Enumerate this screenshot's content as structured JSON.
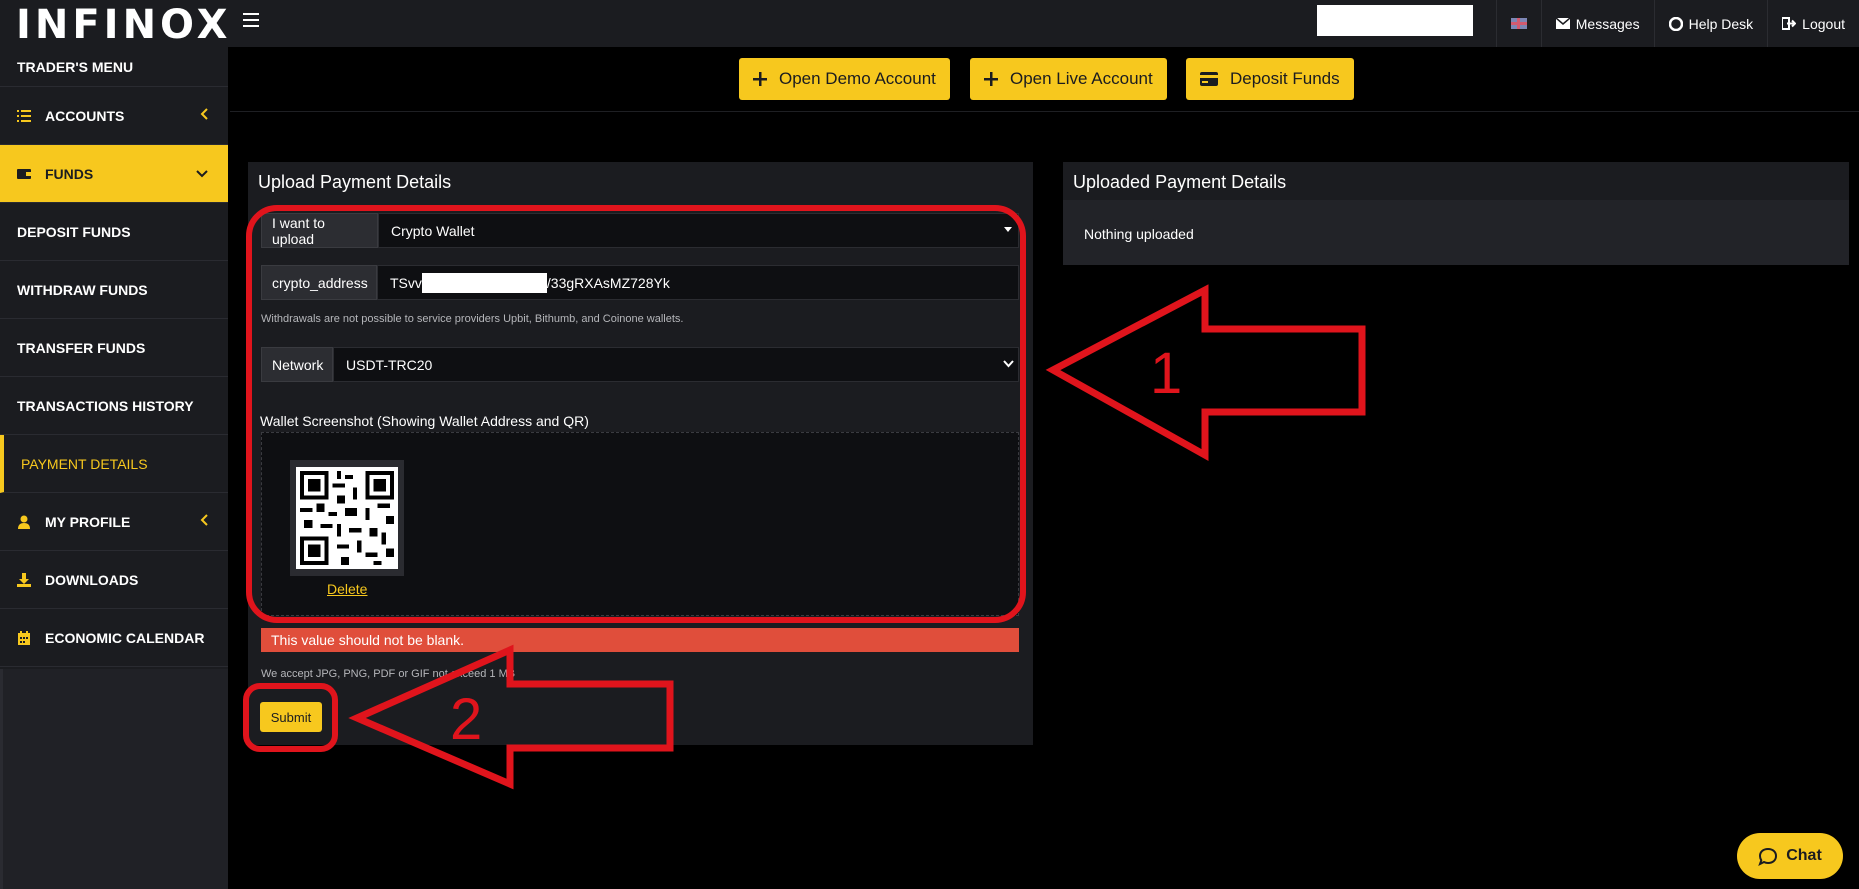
{
  "header": {
    "logo": "INFINOX",
    "nav": [
      {
        "label": "Messages",
        "icon": "envelope-icon"
      },
      {
        "label": "Help Desk",
        "icon": "lifebuoy-icon"
      },
      {
        "label": "Logout",
        "icon": "logout-icon"
      }
    ]
  },
  "sidebar": {
    "title": "TRADER'S MENU",
    "items": [
      {
        "label": "ACCOUNTS",
        "icon": "list-icon"
      },
      {
        "label": "FUNDS",
        "icon": "wallet-icon"
      },
      {
        "label": "DEPOSIT FUNDS"
      },
      {
        "label": "WITHDRAW FUNDS"
      },
      {
        "label": "TRANSFER FUNDS"
      },
      {
        "label": "TRANSACTIONS HISTORY"
      },
      {
        "label": "PAYMENT DETAILS"
      },
      {
        "label": "MY PROFILE",
        "icon": "user-icon"
      },
      {
        "label": "DOWNLOADS",
        "icon": "download-icon"
      },
      {
        "label": "ECONOMIC CALENDAR",
        "icon": "calendar-icon"
      }
    ]
  },
  "actions": {
    "open_demo": "Open Demo Account",
    "open_live": "Open Live Account",
    "deposit": "Deposit Funds"
  },
  "upload_panel": {
    "title": "Upload Payment Details",
    "upload_label": "I want to upload",
    "upload_value": "Crypto Wallet",
    "address_label": "crypto_address",
    "address_prefix": "TSvv",
    "address_suffix": "/33gRXAsMZ728Yk",
    "withdraw_note": "Withdrawals are not possible to service providers Upbit, Bithumb, and Coinone wallets.",
    "network_label": "Network",
    "network_value": "USDT-TRC20",
    "screenshot_label": "Wallet Screenshot (Showing Wallet Address and QR)",
    "delete_label": "Delete",
    "error": "This value should not be blank.",
    "accept_note": "We accept JPG, PNG, PDF or GIF not exceed 1 MB",
    "submit_label": "Submit"
  },
  "uploaded_panel": {
    "title": "Uploaded Payment Details",
    "empty_text": "Nothing uploaded"
  },
  "annotations": {
    "arrow1_number": "1",
    "arrow2_number": "2",
    "color": "#e0141c"
  },
  "chat": {
    "label": "Chat"
  },
  "colors": {
    "accent": "#f7c81e",
    "error": "#e04e3b",
    "panel": "#1b1c20"
  }
}
